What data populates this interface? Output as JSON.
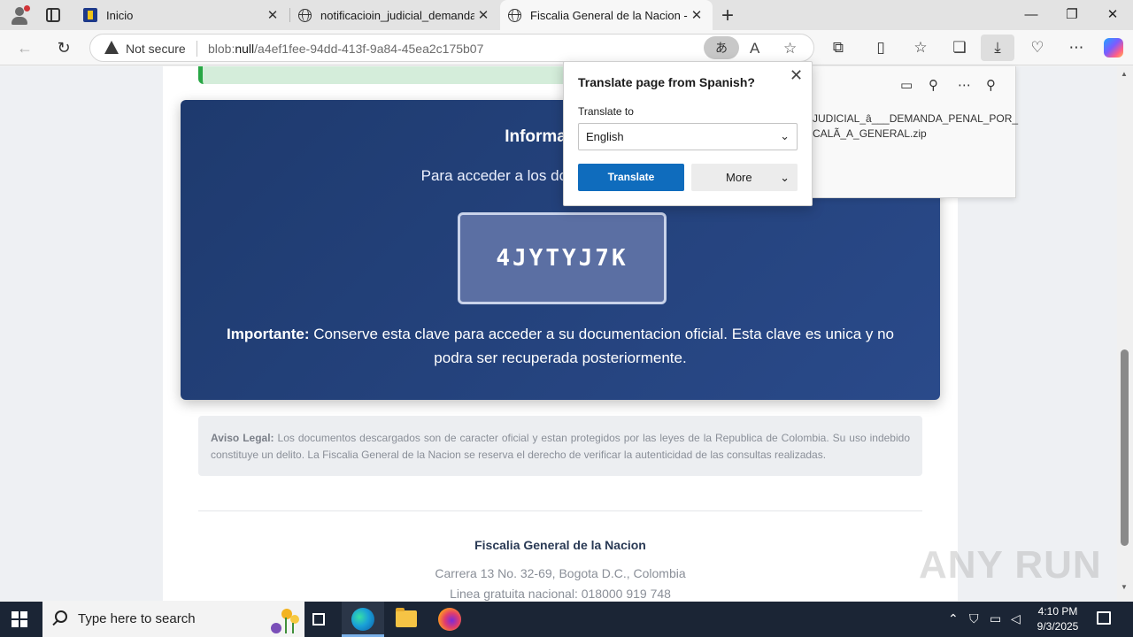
{
  "browser": {
    "tabs": [
      {
        "title": "Inicio",
        "active": false
      },
      {
        "title": "notificacioin_judicial_demanda_pe",
        "active": false
      },
      {
        "title": "Fiscalia General de la Nacion - Sis",
        "active": true
      }
    ],
    "window_controls": {
      "minimize": "—",
      "restore": "❐",
      "close": "✕"
    },
    "security_label": "Not secure",
    "url_scheme": "blob:",
    "url_host": "null",
    "url_path": "/a4ef1fee-94dd-413f-9a84-45ea2c175b07"
  },
  "translate_popup": {
    "title": "Translate page from Spanish?",
    "label": "Translate to",
    "selected_language": "English",
    "translate_button": "Translate",
    "more_button": "More",
    "translate_pill_icon": "あ"
  },
  "downloads": {
    "file_line1": "JUDICIAL_â___DEMANDA_PENAL_POR_",
    "file_line2": "CALÃ_A_GENERAL.zip"
  },
  "page": {
    "info_title": "Informacion d",
    "info_desc": "Para acceder a los documentos protegido",
    "access_key": "4JYTYJ7K",
    "important_label": "Importante:",
    "important_text": " Conserve esta clave para acceder a su documentacion oficial. Esta clave es unica y no podra ser recuperada posteriormente.",
    "legal_label": "Aviso Legal:",
    "legal_text": " Los documentos descargados son de caracter oficial y estan protegidos por las leyes de la Republica de Colombia. Su uso indebido constituye un delito. La Fiscalia General de la Nacion se reserva el derecho de verificar la autenticidad de las consultas realizadas.",
    "footer_name": "Fiscalia General de la Nacion",
    "footer_address": "Carrera 13 No. 32-69, Bogota D.C., Colombia",
    "footer_line": "Linea gratuita nacional: 018000 919 748"
  },
  "taskbar": {
    "search_placeholder": "Type here to search",
    "time": "4:10 PM",
    "date": "9/3/2025"
  },
  "watermark": "ANY RUN",
  "colors": {
    "card_bg": "#1e3a6e",
    "translate_button": "#0f6cbd",
    "success_strip": "#d4edda",
    "taskbar": "#1b2535"
  }
}
